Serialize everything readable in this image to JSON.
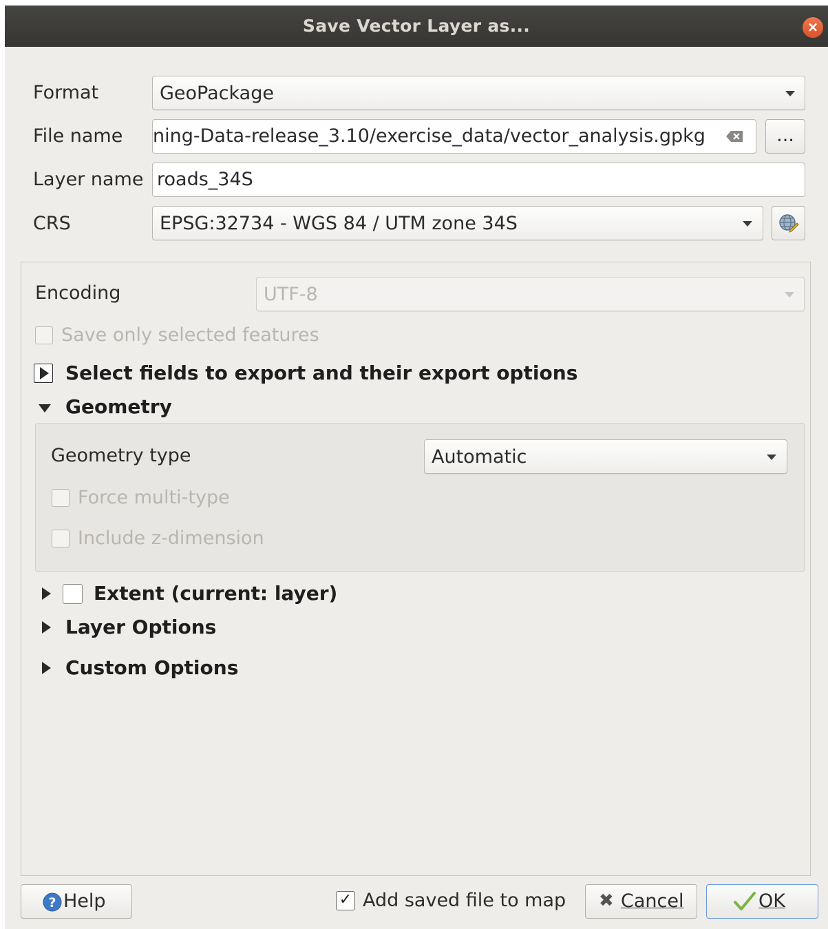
{
  "window": {
    "title": "Save Vector Layer as..."
  },
  "form": {
    "format_label": "Format",
    "format_value": "GeoPackage",
    "filename_label": "File name",
    "filename_value": "ning-Data-release_3.10/exercise_data/vector_analysis.gpkg",
    "browse_label": "...",
    "layername_label": "Layer name",
    "layername_value": "roads_34S",
    "crs_label": "CRS",
    "crs_value": "EPSG:32734 - WGS 84 / UTM zone 34S"
  },
  "options": {
    "encoding_label": "Encoding",
    "encoding_value": "UTF-8",
    "save_selected_label": "Save only selected features",
    "select_fields_label": "Select fields to export and their export options",
    "geometry_label": "Geometry",
    "geometry_type_label": "Geometry type",
    "geometry_type_value": "Automatic",
    "force_multi_label": "Force multi-type",
    "include_z_label": "Include z-dimension",
    "extent_label": "Extent (current: layer)",
    "layer_options_label": "Layer Options",
    "custom_options_label": "Custom Options"
  },
  "footer": {
    "help_label": "Help",
    "add_to_map_label": "Add saved file to map",
    "add_to_map_checked": true,
    "cancel_label": "Cancel",
    "ok_label": "OK"
  },
  "icons": {
    "help": "help-icon",
    "cancel": "cross-icon",
    "ok": "checkmark-icon",
    "crs_selector": "globe-icon",
    "clear": "clear-text-icon"
  },
  "colors": {
    "titlebar": "#3f3e3a",
    "close": "#e8613a",
    "dialog_bg": "#efedea",
    "ok_border": "#6a9ad8"
  }
}
